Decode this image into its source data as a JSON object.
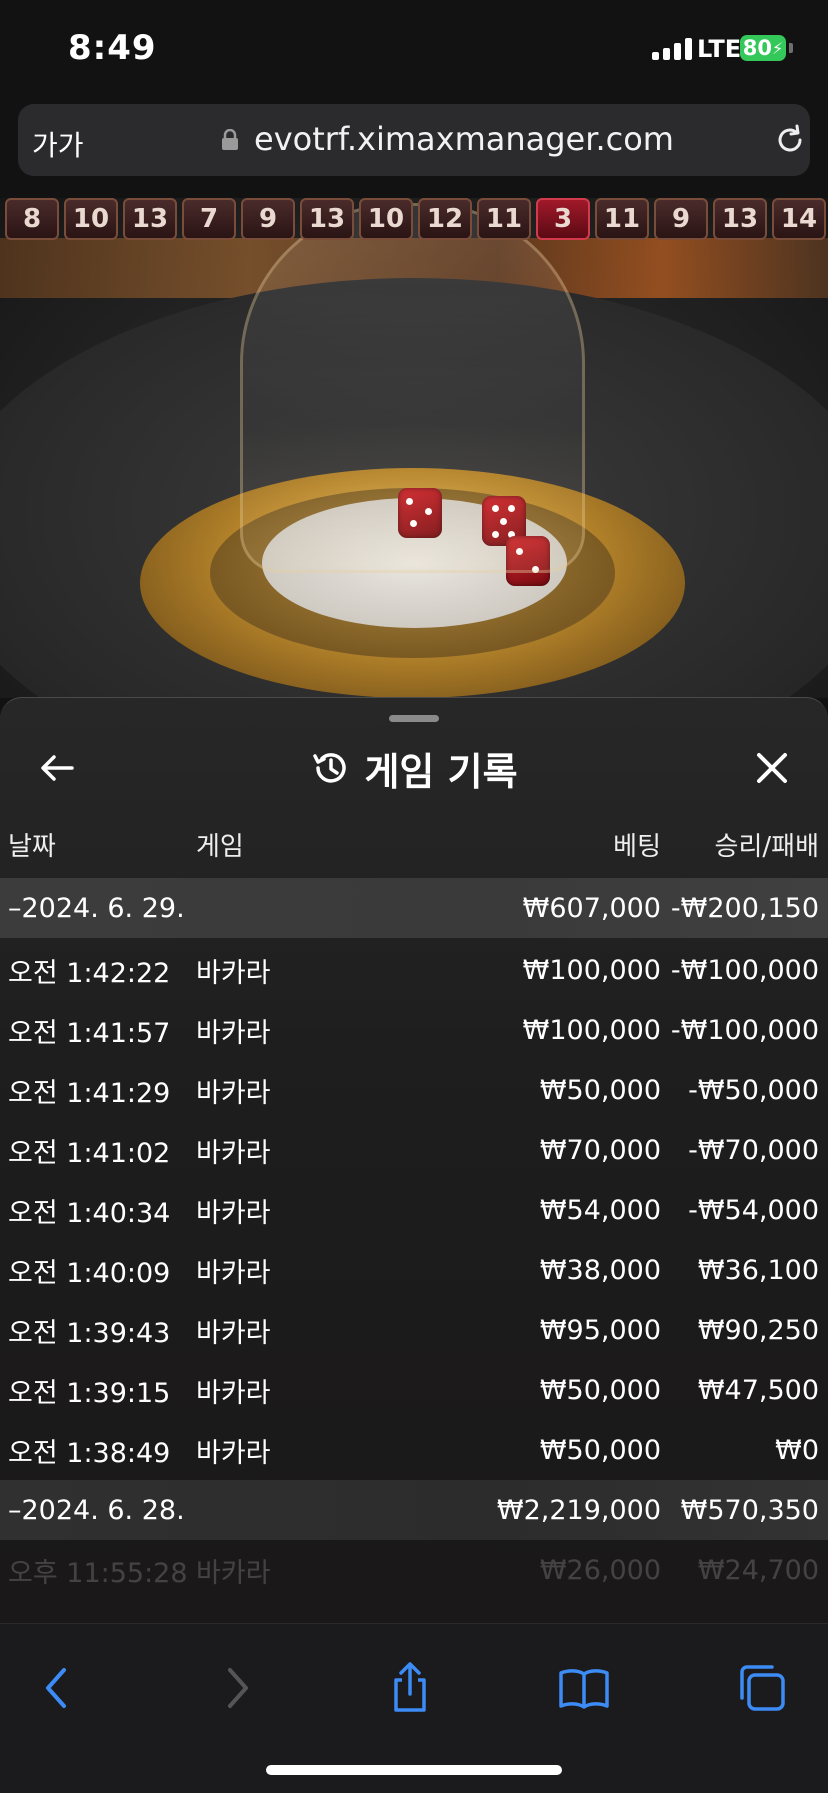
{
  "status_bar": {
    "time": "8:49",
    "network": "LTE",
    "battery": "80"
  },
  "url_bar": {
    "text_size_label": "가가",
    "domain": "evotrf.ximaxmanager.com"
  },
  "roadmap": [
    {
      "value": "8",
      "red": false
    },
    {
      "value": "10",
      "red": false
    },
    {
      "value": "13",
      "red": false
    },
    {
      "value": "7",
      "red": false
    },
    {
      "value": "9",
      "red": false
    },
    {
      "value": "13",
      "red": false
    },
    {
      "value": "10",
      "red": false
    },
    {
      "value": "12",
      "red": false
    },
    {
      "value": "11",
      "red": false
    },
    {
      "value": "3",
      "red": true
    },
    {
      "value": "11",
      "red": false
    },
    {
      "value": "9",
      "red": false
    },
    {
      "value": "13",
      "red": false
    },
    {
      "value": "14",
      "red": false
    }
  ],
  "history": {
    "title": "게임 기록",
    "columns": {
      "date": "날짜",
      "game": "게임",
      "bet": "베팅",
      "result": "승리/패배"
    },
    "groups": [
      {
        "date": "–2024. 6. 29.",
        "bet": "₩607,000",
        "result": "-₩200,150",
        "rows": [
          {
            "time": "오전 1:42:22",
            "game": "바카라",
            "bet": "₩100,000",
            "result": "-₩100,000"
          },
          {
            "time": "오전 1:41:57",
            "game": "바카라",
            "bet": "₩100,000",
            "result": "-₩100,000"
          },
          {
            "time": "오전 1:41:29",
            "game": "바카라",
            "bet": "₩50,000",
            "result": "-₩50,000"
          },
          {
            "time": "오전 1:41:02",
            "game": "바카라",
            "bet": "₩70,000",
            "result": "-₩70,000"
          },
          {
            "time": "오전 1:40:34",
            "game": "바카라",
            "bet": "₩54,000",
            "result": "-₩54,000"
          },
          {
            "time": "오전 1:40:09",
            "game": "바카라",
            "bet": "₩38,000",
            "result": "₩36,100"
          },
          {
            "time": "오전 1:39:43",
            "game": "바카라",
            "bet": "₩95,000",
            "result": "₩90,250"
          },
          {
            "time": "오전 1:39:15",
            "game": "바카라",
            "bet": "₩50,000",
            "result": "₩47,500"
          },
          {
            "time": "오전 1:38:49",
            "game": "바카라",
            "bet": "₩50,000",
            "result": "₩0"
          }
        ]
      },
      {
        "date": "–2024. 6. 28.",
        "bet": "₩2,219,000",
        "result": "₩570,350",
        "rows": [
          {
            "time": "오후 11:55:28",
            "game": "바카라",
            "bet": "₩26,000",
            "result": "₩24,700"
          }
        ]
      }
    ]
  },
  "colors": {
    "accent_blue": "#3d8bf5",
    "battery_green": "#34c759"
  }
}
